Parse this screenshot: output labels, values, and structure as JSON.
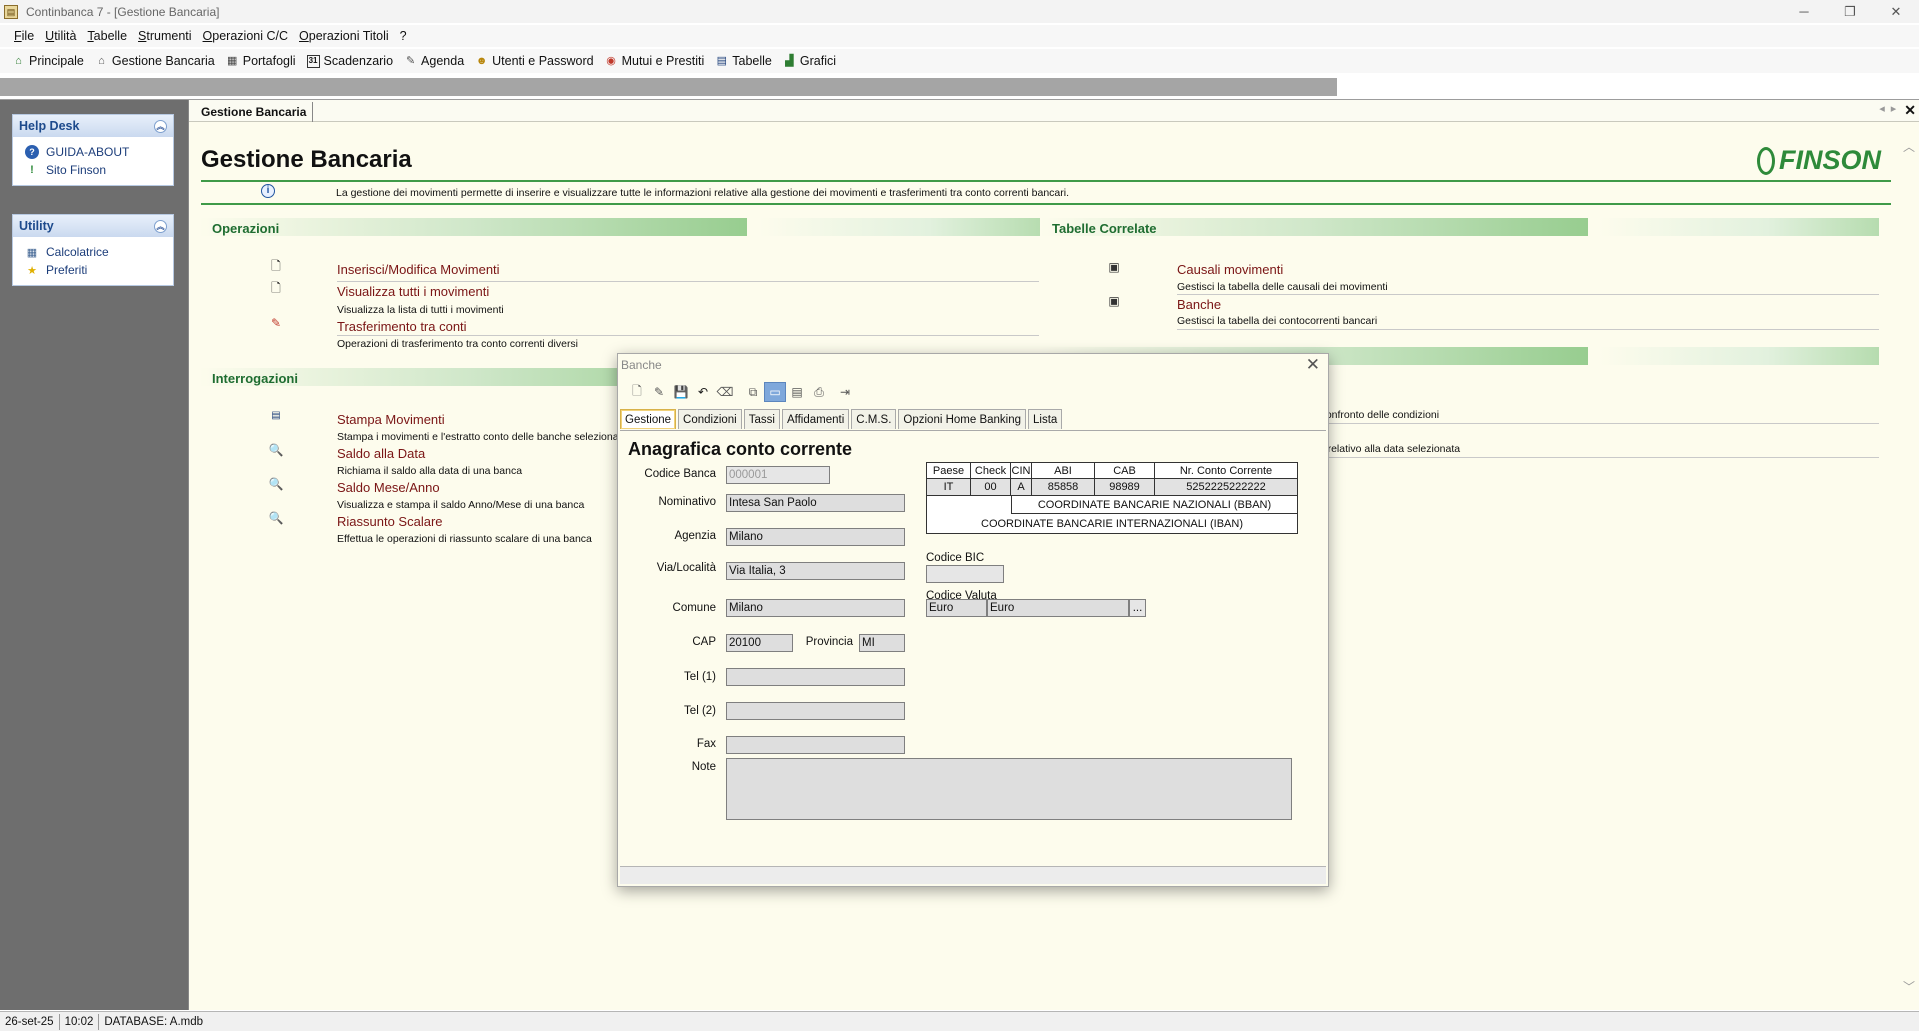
{
  "window": {
    "title": "Continbanca 7 - [Gestione Bancaria]",
    "app_icon": "ledger-icon"
  },
  "menu": [
    "File",
    "Utilità",
    "Tabelle",
    "Strumenti",
    "Operazioni C/C",
    "Operazioni Titoli",
    "?"
  ],
  "toolbar": {
    "items": [
      {
        "label": "Principale",
        "icon": "home-icon"
      },
      {
        "label": "Gestione Bancaria",
        "icon": "bank-icon"
      },
      {
        "label": "Portafogli",
        "icon": "portfolio-icon"
      },
      {
        "label": "Scadenzario",
        "icon": "calendar-icon"
      },
      {
        "label": "Agenda",
        "icon": "agenda-icon"
      },
      {
        "label": "Utenti e Password",
        "icon": "users-icon"
      },
      {
        "label": "Mutui e Prestiti",
        "icon": "loan-icon"
      },
      {
        "label": "Tabelle",
        "icon": "table-icon"
      },
      {
        "label": "Grafici",
        "icon": "chart-icon"
      }
    ]
  },
  "sidebar": {
    "helpdesk": {
      "title": "Help Desk",
      "items": [
        {
          "label": "GUIDA-ABOUT",
          "icon": "help-icon"
        },
        {
          "label": "Sito Finson",
          "icon": "finson-icon"
        }
      ]
    },
    "utility": {
      "title": "Utility",
      "items": [
        {
          "label": "Calcolatrice",
          "icon": "calculator-icon"
        },
        {
          "label": "Preferiti",
          "icon": "star-icon"
        }
      ]
    }
  },
  "main": {
    "doc_tab": "Gestione Bancaria",
    "page_title": "Gestione Bancaria",
    "logo": "FINSON",
    "info": "La gestione dei movimenti permette di inserire e visualizzare tutte le informazioni relative alla gestione dei movimenti e trasferimenti tra conto correnti bancari.",
    "operazioni": {
      "title": "Operazioni",
      "items": [
        {
          "label": "Inserisci/Modifica Movimenti",
          "desc": ""
        },
        {
          "label": "Visualizza tutti i movimenti",
          "desc": "Visualizza la lista di tutti i movimenti"
        },
        {
          "label": "Trasferimento tra conti",
          "desc": "Operazioni di trasferimento tra conto correnti diversi"
        }
      ]
    },
    "tabelle": {
      "title": "Tabelle Correlate",
      "items": [
        {
          "label": "Causali movimenti",
          "desc": "Gestisci la tabella delle causali dei movimenti"
        },
        {
          "label": "Banche",
          "desc": "Gestisci la tabella dei contocorrenti bancari"
        }
      ]
    },
    "hidden_right_descs": [
      "il confronto delle condizioni",
      "do relativo alla data selezionata"
    ],
    "interrogazioni": {
      "title": "Interrogazioni",
      "items": [
        {
          "label": "Stampa Movimenti",
          "desc": "Stampa i movimenti e l'estratto conto delle banche selezionate"
        },
        {
          "label": "Saldo alla Data",
          "desc": "Richiama il saldo alla data di una banca"
        },
        {
          "label": "Saldo Mese/Anno",
          "desc": "Visualizza e stampa il saldo Anno/Mese di una banca"
        },
        {
          "label": "Riassunto Scalare",
          "desc": "Effettua le operazioni di riassunto scalare di una banca"
        }
      ]
    }
  },
  "dialog": {
    "title": "Banche",
    "tabs": [
      "Gestione",
      "Condizioni",
      "Tassi",
      "Affidamenti",
      "C.M.S.",
      "Opzioni Home Banking",
      "Lista"
    ],
    "panel_title": "Anagrafica conto corrente",
    "fields": {
      "codice_banca": {
        "label": "Codice Banca",
        "value": "000001"
      },
      "nominativo": {
        "label": "Nominativo",
        "value": "Intesa San Paolo"
      },
      "agenzia": {
        "label": "Agenzia",
        "value": "Milano"
      },
      "via": {
        "label": "Via/Località",
        "value": "Via Italia, 3"
      },
      "comune": {
        "label": "Comune",
        "value": "Milano"
      },
      "cap": {
        "label": "CAP",
        "value": "20100"
      },
      "provincia": {
        "label": "Provincia",
        "value": "MI"
      },
      "tel1": {
        "label": "Tel (1)",
        "value": ""
      },
      "tel2": {
        "label": "Tel (2)",
        "value": ""
      },
      "fax": {
        "label": "Fax",
        "value": ""
      },
      "note": {
        "label": "Note",
        "value": ""
      },
      "bic": {
        "label": "Codice BIC",
        "value": ""
      },
      "valuta": {
        "label": "Codice Valuta",
        "code": "Euro",
        "name": "Euro",
        "button": "..."
      }
    },
    "coord": {
      "headers": [
        "Paese",
        "Check",
        "CIN",
        "ABI",
        "CAB",
        "Nr. Conto Corrente"
      ],
      "values": [
        "IT",
        "00",
        "A",
        "85858",
        "98989",
        "5252225222222"
      ],
      "bban": "COORDINATE BANCARIE NAZIONALI (BBAN)",
      "iban": "COORDINATE BANCARIE INTERNAZIONALI (IBAN)"
    }
  },
  "status": {
    "date": "26-set-25",
    "time": "10:02",
    "db": "DATABASE: A.mdb"
  }
}
